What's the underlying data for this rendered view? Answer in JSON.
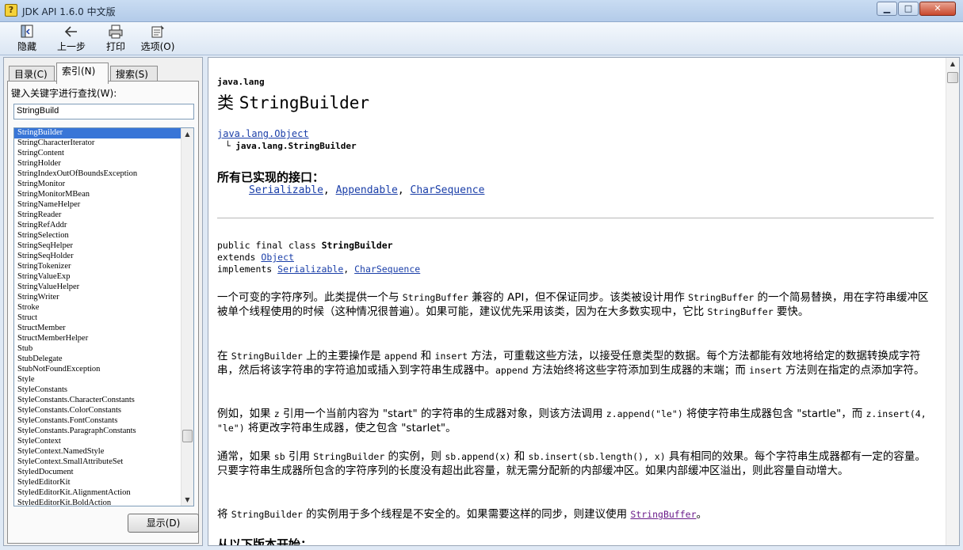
{
  "window": {
    "title": "JDK API 1.6.0 中文版",
    "minimize": "▁",
    "maximize": "□",
    "close": "✕"
  },
  "toolbar": {
    "hide": "隐藏",
    "back": "上一步",
    "print": "打印",
    "options": "选项(O)"
  },
  "tabs": {
    "contents": "目录(C)",
    "index": "索引(N)",
    "search": "搜索(S)"
  },
  "index_panel": {
    "label": "键入关键字进行查找(W):",
    "query": "StringBuild",
    "display_button": "显示(D)",
    "items": [
      "StringBuilder",
      "StringCharacterIterator",
      "StringContent",
      "StringHolder",
      "StringIndexOutOfBoundsException",
      "StringMonitor",
      "StringMonitorMBean",
      "StringNameHelper",
      "StringReader",
      "StringRefAddr",
      "StringSelection",
      "StringSeqHelper",
      "StringSeqHolder",
      "StringTokenizer",
      "StringValueExp",
      "StringValueHelper",
      "StringWriter",
      "Stroke",
      "Struct",
      "StructMember",
      "StructMemberHelper",
      "Stub",
      "StubDelegate",
      "StubNotFoundException",
      "Style",
      "StyleConstants",
      "StyleConstants.CharacterConstants",
      "StyleConstants.ColorConstants",
      "StyleConstants.FontConstants",
      "StyleConstants.ParagraphConstants",
      "StyleContext",
      "StyleContext.NamedStyle",
      "StyleContext.SmallAttributeSet",
      "StyledDocument",
      "StyledEditorKit",
      "StyledEditorKit.AlignmentAction",
      "StyledEditorKit.BoldAction"
    ]
  },
  "doc": {
    "package": "java.lang",
    "title_prefix": "类 ",
    "title_class": "StringBuilder",
    "hierarchy_parent": "java.lang.Object",
    "hierarchy_child": "└ java.lang.StringBuilder",
    "interfaces_heading": "所有已实现的接口：",
    "interfaces": [
      "Serializable",
      "Appendable",
      "CharSequence"
    ],
    "decl_line1_prefix": "public final class ",
    "decl_line1_class": "StringBuilder",
    "decl_line2_prefix": "extends ",
    "decl_line2_link": "Object",
    "decl_line3_prefix": "implements ",
    "decl_line3_link1": "Serializable",
    "decl_line3_link2": "CharSequence",
    "p1": [
      {
        "t": "一个可变的字符序列。此类提供一个与 "
      },
      {
        "c": "StringBuffer"
      },
      {
        "t": " 兼容的 API，但不保证同步。该类被设计用作 "
      },
      {
        "c": "StringBuffer"
      },
      {
        "t": " 的一个简易替换，用在字符串缓冲区被单个线程使用的时候（这种情况很普遍）。如果可能，建议优先采用该类，因为在大多数实现中，它比 "
      },
      {
        "c": "StringBuffer"
      },
      {
        "t": " 要快。"
      }
    ],
    "p2": [
      {
        "t": "在 "
      },
      {
        "c": "StringBuilder"
      },
      {
        "t": " 上的主要操作是 "
      },
      {
        "c": "append"
      },
      {
        "t": " 和 "
      },
      {
        "c": "insert"
      },
      {
        "t": " 方法，可重载这些方法，以接受任意类型的数据。每个方法都能有效地将给定的数据转换成字符串，然后将该字符串的字符追加或插入到字符串生成器中。"
      },
      {
        "c": "append"
      },
      {
        "t": " 方法始终将这些字符添加到生成器的末端；而 "
      },
      {
        "c": "insert"
      },
      {
        "t": " 方法则在指定的点添加字符。"
      }
    ],
    "p3": [
      {
        "t": "例如，如果 "
      },
      {
        "c": "z"
      },
      {
        "t": " 引用一个当前内容为 \"start\" 的字符串的生成器对象，则该方法调用 "
      },
      {
        "c": "z.append(\"le\")"
      },
      {
        "t": " 将使字符串生成器包含 \"startle\"，而 "
      },
      {
        "c": "z.insert(4, \"le\")"
      },
      {
        "t": " 将更改字符串生成器，使之包含 \"starlet\"。"
      }
    ],
    "p4": [
      {
        "t": "通常，如果 "
      },
      {
        "c": "sb"
      },
      {
        "t": " 引用 "
      },
      {
        "c": "StringBuilder"
      },
      {
        "t": " 的实例，则 "
      },
      {
        "c": "sb.append(x)"
      },
      {
        "t": " 和 "
      },
      {
        "c": "sb.insert(sb.length(), x)"
      },
      {
        "t": " 具有相同的效果。每个字符串生成器都有一定的容量。只要字符串生成器所包含的字符序列的长度没有超出此容量，就无需分配新的内部缓冲区。如果内部缓冲区溢出，则此容量自动增大。"
      }
    ],
    "p5_prefix": "将 ",
    "p5_code": "StringBuilder",
    "p5_middle": " 的实例用于多个线程是不安全的。如果需要这样的同步，则建议使用 ",
    "p5_link": "StringBuffer",
    "p5_suffix": "。",
    "since_heading": "从以下版本开始："
  }
}
